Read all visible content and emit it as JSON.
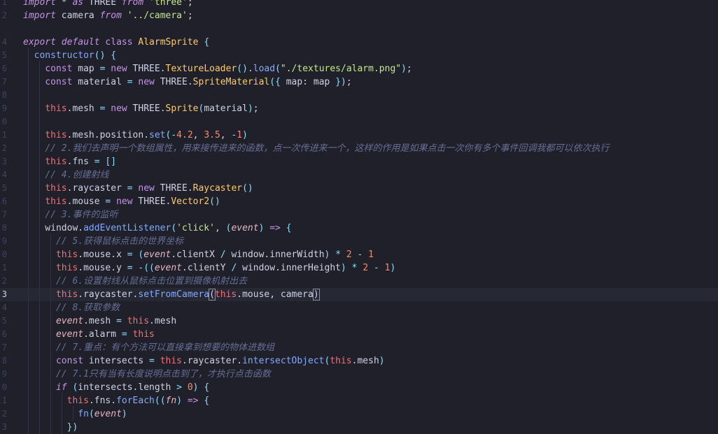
{
  "editor": {
    "colors": {
      "background": "#1f2029",
      "keyword": "#c792ea",
      "function": "#82aaff",
      "class": "#ffcb6b",
      "string": "#c3e88d",
      "number": "#f78c6c",
      "comment": "#676e95",
      "this": "#f07178"
    },
    "current_line_number": "3",
    "lines": [
      {
        "n": "1",
        "tokens": [
          [
            "ki",
            "import"
          ],
          [
            "pl",
            " * "
          ],
          [
            "ki",
            "as"
          ],
          [
            "pl",
            " THREE "
          ],
          [
            "ki",
            "from"
          ],
          [
            "pl",
            " "
          ],
          [
            "s",
            "'three'"
          ],
          [
            "pl",
            ";"
          ]
        ]
      },
      {
        "n": "2",
        "tokens": [
          [
            "ki",
            "import"
          ],
          [
            "pl",
            " camera "
          ],
          [
            "ki",
            "from"
          ],
          [
            "pl",
            " "
          ],
          [
            "s",
            "'../camera'"
          ],
          [
            "pl",
            ";"
          ]
        ]
      },
      {
        "n": "",
        "tokens": []
      },
      {
        "n": "4",
        "tokens": [
          [
            "ki",
            "export"
          ],
          [
            "pl",
            " "
          ],
          [
            "ki",
            "default"
          ],
          [
            "pl",
            " "
          ],
          [
            "k",
            "class"
          ],
          [
            "pl",
            " "
          ],
          [
            "c",
            "AlarmSprite"
          ],
          [
            "pl",
            " "
          ],
          [
            "o",
            "{"
          ]
        ]
      },
      {
        "n": "5",
        "tokens": [
          [
            "pl",
            "  "
          ],
          [
            "f",
            "constructor"
          ],
          [
            "o",
            "()"
          ],
          [
            "pl",
            " "
          ],
          [
            "o",
            "{"
          ]
        ]
      },
      {
        "n": "6",
        "tokens": [
          [
            "pl",
            "    "
          ],
          [
            "k",
            "const"
          ],
          [
            "pl",
            " map "
          ],
          [
            "o",
            "="
          ],
          [
            "pl",
            " "
          ],
          [
            "k",
            "new"
          ],
          [
            "pl",
            " THREE."
          ],
          [
            "c",
            "TextureLoader"
          ],
          [
            "o",
            "()"
          ],
          [
            "pl",
            "."
          ],
          [
            "f",
            "load"
          ],
          [
            "o",
            "("
          ],
          [
            "s",
            "\"./textures/alarm.png\""
          ],
          [
            "o",
            ")"
          ],
          [
            "pl",
            ";"
          ]
        ]
      },
      {
        "n": "7",
        "tokens": [
          [
            "pl",
            "    "
          ],
          [
            "k",
            "const"
          ],
          [
            "pl",
            " material "
          ],
          [
            "o",
            "="
          ],
          [
            "pl",
            " "
          ],
          [
            "k",
            "new"
          ],
          [
            "pl",
            " THREE."
          ],
          [
            "c",
            "SpriteMaterial"
          ],
          [
            "o",
            "({"
          ],
          [
            "pl",
            " map: map "
          ],
          [
            "o",
            "})"
          ],
          [
            "pl",
            ";"
          ]
        ]
      },
      {
        "n": "8",
        "tokens": []
      },
      {
        "n": "9",
        "tokens": [
          [
            "pl",
            "    "
          ],
          [
            "t",
            "this"
          ],
          [
            "pl",
            ".mesh "
          ],
          [
            "o",
            "="
          ],
          [
            "pl",
            " "
          ],
          [
            "k",
            "new"
          ],
          [
            "pl",
            " THREE."
          ],
          [
            "c",
            "Sprite"
          ],
          [
            "o",
            "("
          ],
          [
            "pl",
            "material"
          ],
          [
            "o",
            ")"
          ],
          [
            "pl",
            ";"
          ]
        ]
      },
      {
        "n": "0",
        "tokens": []
      },
      {
        "n": "1",
        "tokens": [
          [
            "pl",
            "    "
          ],
          [
            "t",
            "this"
          ],
          [
            "pl",
            ".mesh.position."
          ],
          [
            "f",
            "set"
          ],
          [
            "o",
            "("
          ],
          [
            "o",
            "-"
          ],
          [
            "n",
            "4.2"
          ],
          [
            "pl",
            ", "
          ],
          [
            "n",
            "3.5"
          ],
          [
            "pl",
            ", "
          ],
          [
            "o",
            "-"
          ],
          [
            "n",
            "1"
          ],
          [
            "o",
            ")"
          ]
        ]
      },
      {
        "n": "2",
        "tokens": [
          [
            "pl",
            "    "
          ],
          [
            "cm",
            "// 2.我们去声明一个数组属性，用来接传进来的函数，点一次传进来一个，这样的作用是如果点击一次你有多个事件回调我都可以依次执行"
          ]
        ]
      },
      {
        "n": "3",
        "tokens": [
          [
            "pl",
            "    "
          ],
          [
            "t",
            "this"
          ],
          [
            "pl",
            ".fns "
          ],
          [
            "o",
            "="
          ],
          [
            "pl",
            " "
          ],
          [
            "o",
            "[]"
          ]
        ]
      },
      {
        "n": "4",
        "tokens": [
          [
            "pl",
            "    "
          ],
          [
            "cm",
            "// 4.创建射线"
          ]
        ]
      },
      {
        "n": "5",
        "tokens": [
          [
            "pl",
            "    "
          ],
          [
            "t",
            "this"
          ],
          [
            "pl",
            ".raycaster "
          ],
          [
            "o",
            "="
          ],
          [
            "pl",
            " "
          ],
          [
            "k",
            "new"
          ],
          [
            "pl",
            " THREE."
          ],
          [
            "c",
            "Raycaster"
          ],
          [
            "o",
            "()"
          ]
        ]
      },
      {
        "n": "6",
        "tokens": [
          [
            "pl",
            "    "
          ],
          [
            "t",
            "this"
          ],
          [
            "pl",
            ".mouse "
          ],
          [
            "o",
            "="
          ],
          [
            "pl",
            " "
          ],
          [
            "k",
            "new"
          ],
          [
            "pl",
            " THREE."
          ],
          [
            "c",
            "Vector2"
          ],
          [
            "o",
            "()"
          ]
        ]
      },
      {
        "n": "7",
        "tokens": [
          [
            "pl",
            "    "
          ],
          [
            "cm",
            "// 3.事件的监听"
          ]
        ]
      },
      {
        "n": "8",
        "tokens": [
          [
            "pl",
            "    window."
          ],
          [
            "f",
            "addEventListener"
          ],
          [
            "o",
            "("
          ],
          [
            "s",
            "'click'"
          ],
          [
            "pl",
            ", "
          ],
          [
            "o",
            "("
          ],
          [
            "p",
            "event"
          ],
          [
            "o",
            ")"
          ],
          [
            "pl",
            " "
          ],
          [
            "k",
            "=>"
          ],
          [
            "pl",
            " "
          ],
          [
            "o",
            "{"
          ]
        ]
      },
      {
        "n": "9",
        "tokens": [
          [
            "pl",
            "      "
          ],
          [
            "cm",
            "// 5.获得鼠标点击的世界坐标"
          ]
        ]
      },
      {
        "n": "0",
        "tokens": [
          [
            "pl",
            "      "
          ],
          [
            "t",
            "this"
          ],
          [
            "pl",
            ".mouse.x "
          ],
          [
            "o",
            "="
          ],
          [
            "pl",
            " "
          ],
          [
            "o",
            "("
          ],
          [
            "p",
            "event"
          ],
          [
            "pl",
            ".clientX "
          ],
          [
            "o",
            "/"
          ],
          [
            "pl",
            " window.innerWidth"
          ],
          [
            "o",
            ")"
          ],
          [
            "pl",
            " "
          ],
          [
            "o",
            "*"
          ],
          [
            "pl",
            " "
          ],
          [
            "n",
            "2"
          ],
          [
            "pl",
            " "
          ],
          [
            "o",
            "-"
          ],
          [
            "pl",
            " "
          ],
          [
            "n",
            "1"
          ]
        ]
      },
      {
        "n": "1",
        "tokens": [
          [
            "pl",
            "      "
          ],
          [
            "t",
            "this"
          ],
          [
            "pl",
            ".mouse.y "
          ],
          [
            "o",
            "="
          ],
          [
            "pl",
            " "
          ],
          [
            "o",
            "-(("
          ],
          [
            "p",
            "event"
          ],
          [
            "pl",
            ".clientY "
          ],
          [
            "o",
            "/"
          ],
          [
            "pl",
            " window.innerHeight"
          ],
          [
            "o",
            ")"
          ],
          [
            "pl",
            " "
          ],
          [
            "o",
            "*"
          ],
          [
            "pl",
            " "
          ],
          [
            "n",
            "2"
          ],
          [
            "pl",
            " "
          ],
          [
            "o",
            "-"
          ],
          [
            "pl",
            " "
          ],
          [
            "n",
            "1"
          ],
          [
            "o",
            ")"
          ]
        ]
      },
      {
        "n": "2",
        "tokens": [
          [
            "pl",
            "      "
          ],
          [
            "cm",
            "// 6.设置射线从鼠标点击位置到摄像机射出去"
          ]
        ]
      },
      {
        "n": "3",
        "current": true,
        "tokens": [
          [
            "pl",
            "      "
          ],
          [
            "t",
            "this"
          ],
          [
            "pl",
            ".raycaster."
          ],
          [
            "f",
            "setFromCamera"
          ],
          [
            "bm",
            "("
          ],
          [
            "t",
            "this"
          ],
          [
            "pl",
            ".mouse, camera"
          ],
          [
            "bm",
            ")"
          ]
        ]
      },
      {
        "n": "4",
        "tokens": [
          [
            "pl",
            "      "
          ],
          [
            "cm",
            "// 8.获取参数"
          ]
        ]
      },
      {
        "n": "5",
        "tokens": [
          [
            "pl",
            "      "
          ],
          [
            "p",
            "event"
          ],
          [
            "pl",
            ".mesh "
          ],
          [
            "o",
            "="
          ],
          [
            "pl",
            " "
          ],
          [
            "t",
            "this"
          ],
          [
            "pl",
            ".mesh"
          ]
        ]
      },
      {
        "n": "6",
        "tokens": [
          [
            "pl",
            "      "
          ],
          [
            "p",
            "event"
          ],
          [
            "pl",
            ".alarm "
          ],
          [
            "o",
            "="
          ],
          [
            "pl",
            " "
          ],
          [
            "t",
            "this"
          ]
        ]
      },
      {
        "n": "7",
        "tokens": [
          [
            "pl",
            "      "
          ],
          [
            "cm",
            "// 7.重点：有个方法可以直接拿到想要的物体进数组"
          ]
        ]
      },
      {
        "n": "8",
        "tokens": [
          [
            "pl",
            "      "
          ],
          [
            "k",
            "const"
          ],
          [
            "pl",
            " intersects "
          ],
          [
            "o",
            "="
          ],
          [
            "pl",
            " "
          ],
          [
            "t",
            "this"
          ],
          [
            "pl",
            ".raycaster."
          ],
          [
            "f",
            "intersectObject"
          ],
          [
            "o",
            "("
          ],
          [
            "t",
            "this"
          ],
          [
            "pl",
            ".mesh"
          ],
          [
            "o",
            ")"
          ]
        ]
      },
      {
        "n": "9",
        "tokens": [
          [
            "pl",
            "      "
          ],
          [
            "cm",
            "// 7.1只有当有长度说明点击到了，才执行点击函数"
          ]
        ]
      },
      {
        "n": "0",
        "tokens": [
          [
            "pl",
            "      "
          ],
          [
            "ki",
            "if"
          ],
          [
            "pl",
            " "
          ],
          [
            "o",
            "("
          ],
          [
            "pl",
            "intersects.length "
          ],
          [
            "o",
            ">"
          ],
          [
            "pl",
            " "
          ],
          [
            "n",
            "0"
          ],
          [
            "o",
            ")"
          ],
          [
            "pl",
            " "
          ],
          [
            "o",
            "{"
          ]
        ]
      },
      {
        "n": "1",
        "tokens": [
          [
            "pl",
            "        "
          ],
          [
            "t",
            "this"
          ],
          [
            "pl",
            ".fns."
          ],
          [
            "f",
            "forEach"
          ],
          [
            "o",
            "(("
          ],
          [
            "p",
            "fn"
          ],
          [
            "o",
            ")"
          ],
          [
            "pl",
            " "
          ],
          [
            "k",
            "=>"
          ],
          [
            "pl",
            " "
          ],
          [
            "o",
            "{"
          ]
        ]
      },
      {
        "n": "2",
        "tokens": [
          [
            "pl",
            "          "
          ],
          [
            "f",
            "fn"
          ],
          [
            "o",
            "("
          ],
          [
            "p",
            "event"
          ],
          [
            "o",
            ")"
          ]
        ]
      },
      {
        "n": "3",
        "tokens": [
          [
            "pl",
            "        "
          ],
          [
            "o",
            "})"
          ]
        ]
      }
    ]
  }
}
